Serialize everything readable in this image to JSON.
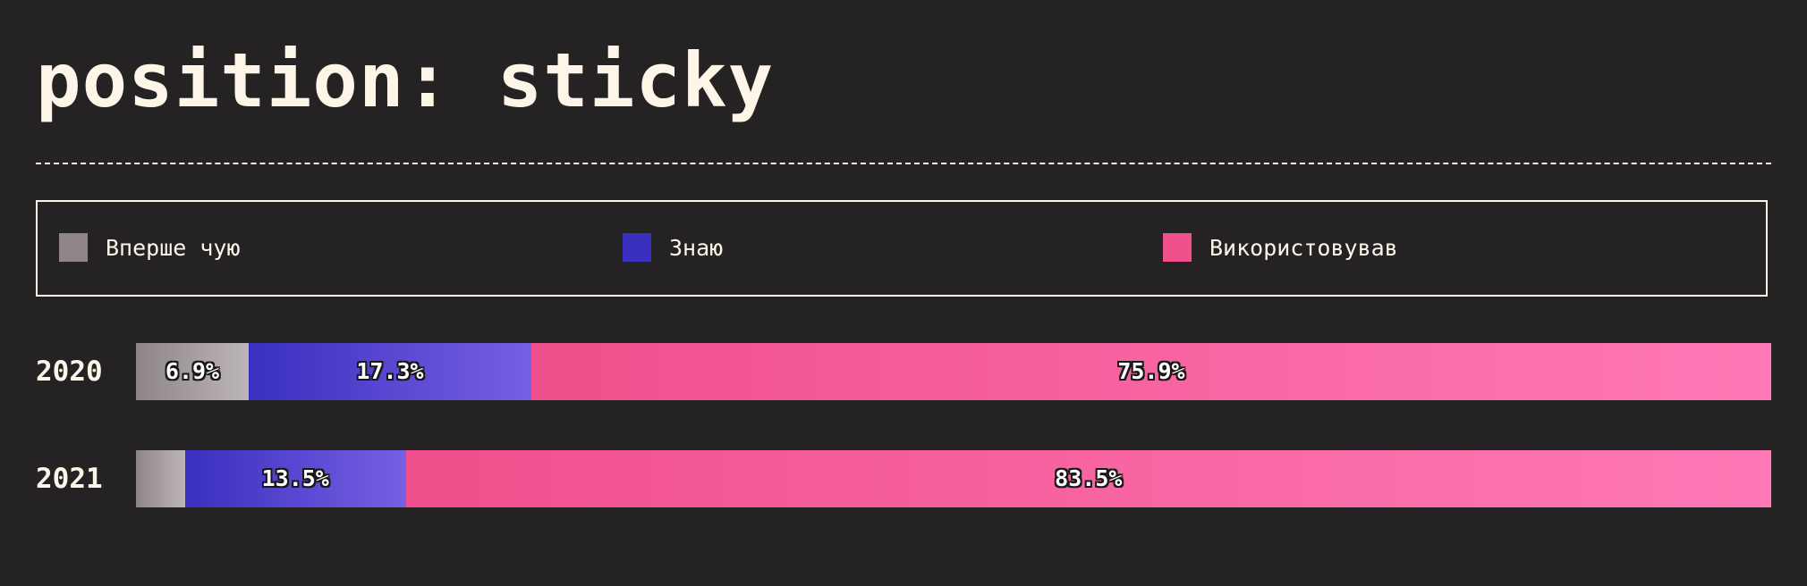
{
  "title": "position: sticky",
  "legend": [
    {
      "label": "Вперше чую",
      "color": "#8E8489"
    },
    {
      "label": "Знаю",
      "color": "#3A2FBF"
    },
    {
      "label": "Використовував",
      "color": "#EF4F8B"
    }
  ],
  "chart_data": {
    "type": "bar",
    "orientation": "horizontal",
    "stacked": true,
    "normalized": true,
    "categories": [
      "2020",
      "2021"
    ],
    "series": [
      {
        "name": "Вперше чую",
        "values": [
          6.9,
          3.0
        ],
        "labels": [
          "6.9%",
          ""
        ],
        "gradient": [
          "#8E8489",
          "#BDB6B9"
        ]
      },
      {
        "name": "Знаю",
        "values": [
          17.3,
          13.5
        ],
        "labels": [
          "17.3%",
          "13.5%"
        ],
        "gradient": [
          "#3A2FBF",
          "#7660E3"
        ]
      },
      {
        "name": "Використовував",
        "values": [
          75.9,
          83.5
        ],
        "labels": [
          "75.9%",
          "83.5%"
        ],
        "gradient": [
          "#EF4F8B",
          "#FF79B6"
        ]
      }
    ]
  }
}
